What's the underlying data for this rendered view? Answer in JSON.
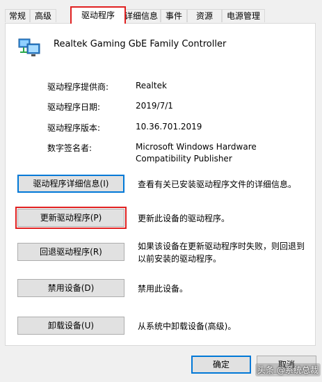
{
  "tabs": [
    "常规",
    "高级",
    "驱动程序",
    "详细信息",
    "事件",
    "资源",
    "电源管理"
  ],
  "active_tab": "驱动程序",
  "device": {
    "name": "Realtek Gaming GbE Family Controller",
    "icon": "network-adapter-icon"
  },
  "properties": {
    "provider_label": "驱动程序提供商:",
    "provider_value": "Realtek",
    "date_label": "驱动程序日期:",
    "date_value": "2019/7/1",
    "version_label": "驱动程序版本:",
    "version_value": "10.36.701.2019",
    "signer_label": "数字签名者:",
    "signer_value_line1": "Microsoft Windows Hardware",
    "signer_value_line2": "Compatibility Publisher"
  },
  "actions": {
    "details_label": "驱动程序详细信息(I)",
    "details_desc": "查看有关已安装驱动程序文件的详细信息。",
    "update_label": "更新驱动程序(P)",
    "update_desc": "更新此设备的驱动程序。",
    "rollback_label": "回退驱动程序(R)",
    "rollback_desc_line1": "如果该设备在更新驱动程序时失败，则回退到",
    "rollback_desc_line2": "以前安装的驱动程序。",
    "disable_label": "禁用设备(D)",
    "disable_desc": "禁用此设备。",
    "uninstall_label": "卸载设备(U)",
    "uninstall_desc": "从系统中卸载设备(高级)。"
  },
  "footer": {
    "ok_label": "确定",
    "cancel_label": "取消"
  },
  "watermark": "头条 @系统总裁",
  "colors": {
    "highlight": "#e02020",
    "focus": "#0078d7",
    "button_bg": "#e1e1e1"
  }
}
